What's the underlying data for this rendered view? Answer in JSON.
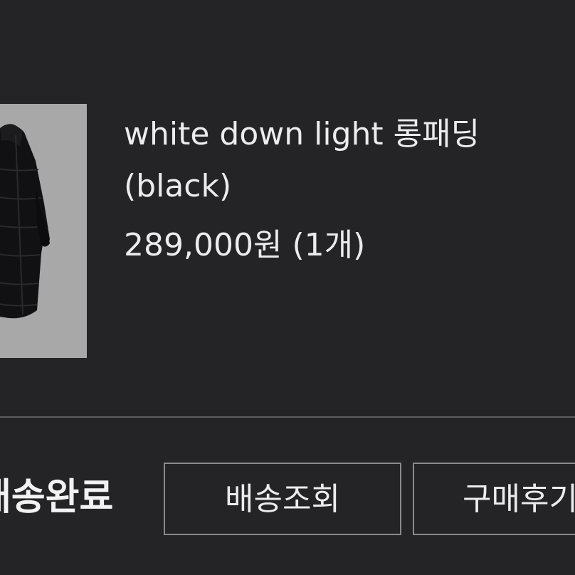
{
  "product": {
    "name_line1": "white down light 롱패딩",
    "name_line2": "(black)",
    "price": "289,000원",
    "quantity": "(1개)",
    "thumbnail_icon": "long-padding-coat-image"
  },
  "order": {
    "status": "배송완료",
    "track_button": "배송조회",
    "review_button": "구매후기"
  },
  "colors": {
    "background": "#242426",
    "text": "#ececec",
    "button_border": "#8a8a8c",
    "divider": "#5c5c5e",
    "thumbnail_bg": "#a8a8a8"
  }
}
